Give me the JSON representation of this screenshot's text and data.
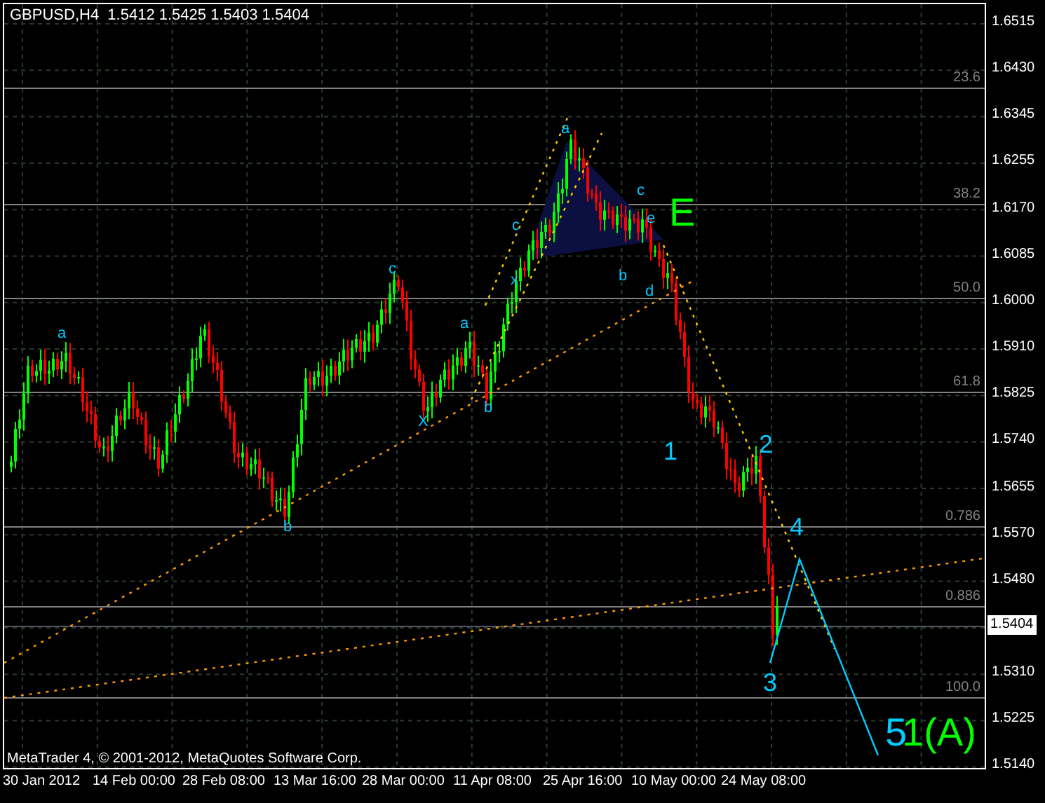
{
  "chart_header": {
    "title": "GBPUSD,H4  1.5412 1.5425 1.5403 1.5404"
  },
  "price_axis": {
    "labels": [
      "1.6515",
      "1.6430",
      "1.6345",
      "1.6255",
      "1.6170",
      "1.6085",
      "1.6000",
      "1.5910",
      "1.5825",
      "1.5740",
      "1.5655",
      "1.5570",
      "1.5480",
      "1.5310",
      "1.5225",
      "1.5140"
    ],
    "current_price": "1.5404"
  },
  "time_axis": {
    "labels": [
      "30 Jan 2012",
      "14 Feb 00:00",
      "28 Feb 08:00",
      "13 Mar 16:00",
      "28 Mar 00:00",
      "11 Apr 08:00",
      "25 Apr 16:00",
      "10 May 00:00",
      "24 May 08:00"
    ]
  },
  "fib_levels": [
    "23.6",
    "38.2",
    "50.0",
    "61.8",
    "0.786",
    "0.886",
    "100.0"
  ],
  "wave_labels": [
    {
      "text": "a",
      "kind": "small",
      "color": "#00ccff"
    },
    {
      "text": "b",
      "kind": "small",
      "color": "#00ccff"
    },
    {
      "text": "c",
      "kind": "small",
      "color": "#00ccff"
    },
    {
      "text": "X",
      "kind": "small",
      "color": "#00ccff"
    },
    {
      "text": "a",
      "kind": "small",
      "color": "#00ccff"
    },
    {
      "text": "b",
      "kind": "small",
      "color": "#00ccff"
    },
    {
      "text": "c",
      "kind": "small",
      "color": "#00ccff"
    },
    {
      "text": "x",
      "kind": "small",
      "color": "#00ccff"
    },
    {
      "text": "a",
      "kind": "small",
      "color": "#00ccff"
    },
    {
      "text": "c",
      "kind": "small",
      "color": "#00ccff"
    },
    {
      "text": "e",
      "kind": "small",
      "color": "#00ccff"
    },
    {
      "text": "b",
      "kind": "small",
      "color": "#00ccff"
    },
    {
      "text": "d",
      "kind": "small",
      "color": "#00ccff"
    },
    {
      "text": "E",
      "kind": "large",
      "color": "#00ff00"
    },
    {
      "text": "1",
      "kind": "medium",
      "color": "#00ccff"
    },
    {
      "text": "2",
      "kind": "medium",
      "color": "#00ccff"
    },
    {
      "text": "3",
      "kind": "medium",
      "color": "#00ccff"
    },
    {
      "text": "4",
      "kind": "medium",
      "color": "#00ccff"
    },
    {
      "text": "5",
      "kind": "large",
      "color": "#00ccff"
    },
    {
      "text": "1(A)",
      "kind": "large",
      "color": "#00ff00"
    }
  ],
  "copyright": "MetaTrader 4, © 2001-2012, MetaQuotes Software Corp."
}
